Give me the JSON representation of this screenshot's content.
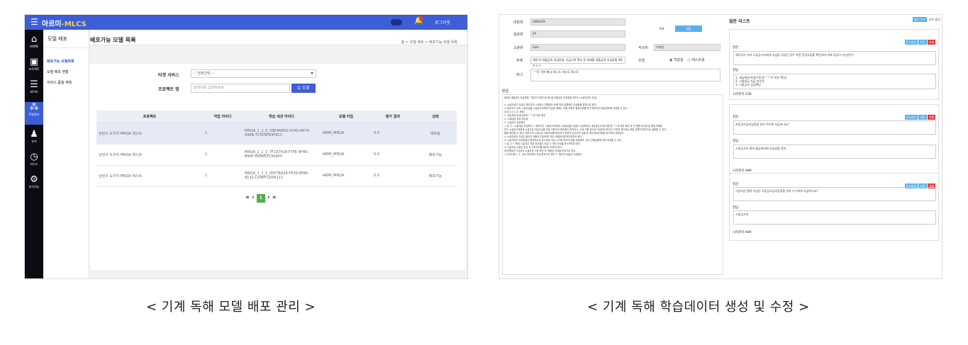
{
  "left": {
    "brand": {
      "prefix": "아르미",
      "suffix": "-MLCS"
    },
    "topbar": {
      "logout": "로그아웃"
    },
    "rail": [
      {
        "icon": "home",
        "label": "HOME"
      },
      {
        "icon": "project",
        "label": "프로젝트"
      },
      {
        "icon": "data",
        "label": "데이터"
      },
      {
        "icon": "model-manage",
        "label": "모델관리"
      },
      {
        "icon": "user",
        "label": "유저"
      },
      {
        "icon": "resource",
        "label": "리소스"
      },
      {
        "icon": "settings",
        "label": "부가기능"
      }
    ],
    "subnav": {
      "title": "모델 배포",
      "items": [
        "배포가능 모델목록",
        "모델 배포 현황",
        "서비스 품질 예측"
      ]
    },
    "page_title": "배포가능 모델 목록",
    "breadcrumb": "홈 > 모델 배포 > 배포가능 모델 목록",
    "filter": {
      "target_label": "타겟 서비스",
      "target_value": "-- 전체선택 --",
      "project_label": "프로젝트 명",
      "project_placeholder": "검색어를 입력하세요",
      "search_button": "Q 조회"
    },
    "table": {
      "headers": [
        "프로젝트",
        "작업 아이디",
        "학습 세션 아이디",
        "모델 타입",
        "평가 결과",
        "상태"
      ],
      "rows": [
        {
          "project": "상담사 도우미 MRQA 테스트",
          "job": "1",
          "session_a": "MRQA_1_1_0_33E4A85D-07A0-4874-",
          "session_b": "946B-7C5C6F64F8CC",
          "type": "ARMI_MRQA",
          "score": "0.0",
          "status": "배포됨"
        },
        {
          "project": "상담사 도우미 MRQA 테스트",
          "job": "1",
          "session_a": "MRQA_1_1_2_7F1A7418-F7FE-4F46-",
          "session_b": "B90F-8586E5C9A955",
          "type": "ARMI_MRQA",
          "score": "0.0",
          "status": "배포가능"
        },
        {
          "project": "상담사 도우미 MRQA 테스트",
          "job": "1",
          "session_a": "MRQA_1_1_1_0007BA28-FE30-4FAE-",
          "session_b": "8132-C04EF1DD6211",
          "type": "ARMI_MRQA",
          "score": "0.0",
          "status": "배포가능"
        }
      ]
    },
    "pager": {
      "first": "«",
      "prev": "‹",
      "current": "1",
      "next": "›",
      "last": "»"
    }
  },
  "right": {
    "fields": {
      "main_cat_label": "대분류",
      "main_cat_value": "UMIDATA",
      "mid_cat_label": "중분류",
      "mid_cat_value": "EP",
      "sub_cat_label": "소분류",
      "sub_cat_value": "Rate",
      "subject_label": "주제",
      "subject_value": "채권·자 대출금의 지급방법, 기금고의 확인 등 게재할 대출금의 지급방법 제1조 (ㄷ)",
      "tag_label": "태그",
      "tag_value": "'ㄱ'로 구분 예시) 태그1, 태그2, 태그3",
      "writer_label": "작성자",
      "writer_value": "이재원",
      "type_label": "유형",
      "type_opt1": "학습용",
      "type_opt2": "테스트용"
    },
    "tabs": [
      "목록",
      "저장"
    ],
    "body_label": "본문",
    "body_text": "제6장 대출금의 지급방법, 기업고의 확인 등 제1절 대출금의 지급방법 제1조 (시설자금의 지급)\n\n① 시설자금의 지급은 채무자의 시설공사 진행정도 등에 따라 분할하여 지급함을 원칙으로 한다.\n② 채무자가 이미 시설자금을 시설공사자에게 지급한 때에는 이를 지원조 증빙서류를 받아 채무자의 예금계좌에 지급할 수 있다.\n(2014.11.14 개정)\n1. 세금계산서(영수증)이 \"ㄱ\"로 여부 확인\n2. 시설대금 지급 영수증\n3. 시설공사 입금확인\n< 참 고 : 시설대금 지급확인 > 채무자가 시설공사자에게 시설대금을 지급한 사실확인은 세금계산서(영수증)에 \"ㄱ\"로 여부 확인 후 전 행원 영수증 등 증빙서류를\n받고 시설공사자에게 시설자금 지급사실을 직접 서면으로 확인함이 원칙이나, 수표·어음 등으로 지급하여 확인이 곤란한 경우에는 해당 은행의 확인으로 갈음할 수 있다.\n통해 확인할 수 있다. 채무자의 시설자금 사용여부를 확인하기 위하여 공사진척 상황 등 관련 증빙서류를 징구하여 검토한다.\n③ 시설자금의 지급은 별도의 계좌로 지급하며 자금 사용용도를 확인하여야 한다.\n④ 시설자금의 지급방법은 원칙적으로 공사대금 지급 시기에 맞추어 분할 지급하며, 공사 진행상황에 따라 조정할 수 있다.\n< 참 고 > 행내 시설자금 관련 여신업무 취급 시 관련 규정을 준수하여야 한다.\n⑤ 시설자금 사업장 완공 후 사후관리를 철저히 하여야 한다.\n공무원법대 기금공무 시설자금 사용 확인 후 대출금 지급을 원칙으로 한다.\n< 유의사항 > 1. 공무 원칙대로 지급 원칙으로 한다 2. 채무자 대출금 지급한다.",
    "qa_title": "질문 리스트",
    "qa_add": "질문 추가",
    "qa_collapse": "모두 접기",
    "card_edit": "문서정보",
    "card_save": "저장",
    "card_delete": "삭제",
    "q_label": "질문",
    "a_label": "정답",
    "cards": [
      {
        "question": "채무자가 이미 시설공사자에게 대금을 지급한 경우 어떤 증빙서류를 확인하여 대체 지급이 가능한가?",
        "answer_lines": [
          "1. 세금계산서(영수증)이 \"ㄱ\"로 여부 확인)",
          "2. 시설대금 지급 영수증",
          "3. 시설공사 입금확인"
        ],
        "start": "시작위치:238"
      },
      {
        "question": "자동공지금리엄정을 받아 어디에 지급하나요?",
        "answer_lines": [
          "시설공사자 명의 예금계좌에 지급함을 원칙"
        ],
        "start": "시작위치:989"
      },
      {
        "question": "시설자금 행의 지급은 자동공지금리엄정을 받아 누구에게 지급하나요?",
        "answer_lines": [
          "시설공사자"
        ],
        "start": "시작위치:989"
      }
    ]
  },
  "captions": [
    "< 기계 독해 모델 배포 관리 >",
    "< 기계 독해 학습데이터 생성 및 수정 >"
  ]
}
